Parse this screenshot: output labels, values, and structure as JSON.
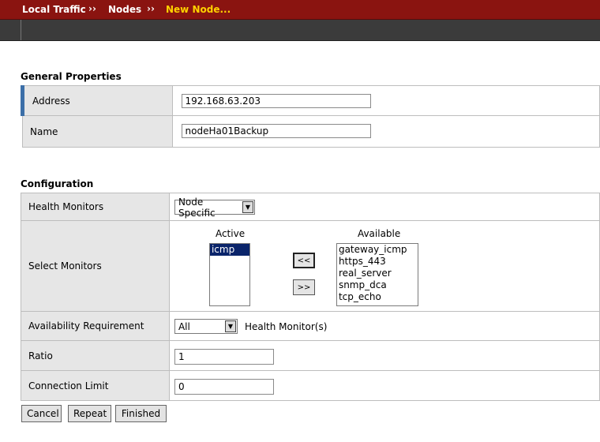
{
  "breadcrumb": {
    "items": [
      "Local Traffic",
      "Nodes",
      "New Node..."
    ],
    "separator": "››"
  },
  "general": {
    "title": "General Properties",
    "address_label": "Address",
    "address_value": "192.168.63.203",
    "name_label": "Name",
    "name_value": "nodeHa01Backup"
  },
  "configuration": {
    "title": "Configuration",
    "health_label": "Health Monitors",
    "health_value": "Node Specific",
    "select_label": "Select Monitors",
    "active_heading": "Active",
    "available_heading": "Available",
    "active_items": [
      "icmp"
    ],
    "available_items": [
      "gateway_icmp",
      "https_443",
      "real_server",
      "snmp_dca",
      "tcp_echo"
    ],
    "move_left_label": "<<",
    "move_right_label": ">>",
    "availability_label": "Availability Requirement",
    "availability_value": "All",
    "availability_suffix": "Health Monitor(s)",
    "ratio_label": "Ratio",
    "ratio_value": "1",
    "conn_label": "Connection Limit",
    "conn_value": "0"
  },
  "actions": {
    "cancel": "Cancel",
    "repeat": "Repeat",
    "finished": "Finished"
  },
  "colors": {
    "header": "#8a1410",
    "current_crumb": "#ffd200",
    "accent": "#3c6fa8"
  }
}
